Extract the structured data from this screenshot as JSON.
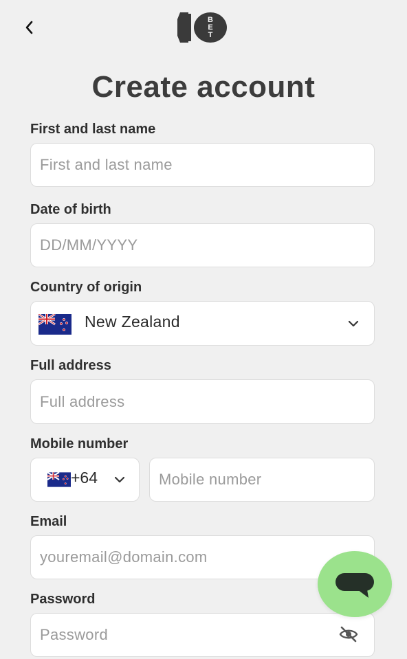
{
  "header": {
    "back_icon": "chevron-left-icon",
    "logo_number": "10",
    "logo_text": "BET",
    "title": "Create account"
  },
  "form": {
    "name": {
      "label": "First and last name",
      "placeholder": "First and last name"
    },
    "dob": {
      "label": "Date of birth",
      "placeholder": "DD/MM/YYYY"
    },
    "country": {
      "label": "Country of origin",
      "value": "New Zealand",
      "flag_icon": "new-zealand-flag-icon"
    },
    "address": {
      "label": "Full address",
      "placeholder": "Full address"
    },
    "mobile": {
      "label": "Mobile number",
      "code": "+64",
      "placeholder": "Mobile number"
    },
    "email": {
      "label": "Email",
      "placeholder": "youremail@domain.com"
    },
    "password": {
      "label": "Password",
      "placeholder": "Password",
      "visibility_icon": "eye-off-icon"
    }
  },
  "chat": {
    "icon": "chat-bubble-icon",
    "color": "#9be28c"
  },
  "colors": {
    "background": "#f0f0f0",
    "title": "#3c3c3c",
    "field_bg": "#ffffff",
    "placeholder": "#9a9a9a"
  }
}
